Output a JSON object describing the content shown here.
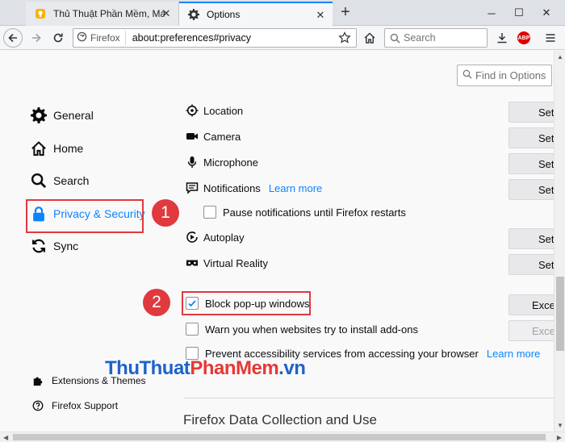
{
  "tabs": [
    {
      "label": "Thủ Thuật Phần Mềm, Máy Tính",
      "close": "✕"
    },
    {
      "label": "Options",
      "close": "✕"
    }
  ],
  "window": {
    "minimize": "─",
    "maximize": "☐",
    "close": "✕",
    "new_tab": "+"
  },
  "nav": {
    "identity_label": "Firefox",
    "url": "about:preferences#privacy",
    "search_placeholder": "Search",
    "abp_label": "ABP"
  },
  "find": {
    "placeholder": "Find in Options"
  },
  "sidebar": {
    "items": [
      {
        "label": "General"
      },
      {
        "label": "Home"
      },
      {
        "label": "Search"
      },
      {
        "label": "Privacy & Security"
      },
      {
        "label": "Sync"
      }
    ],
    "footer": [
      {
        "label": "Extensions & Themes"
      },
      {
        "label": "Firefox Support"
      }
    ]
  },
  "permissions": {
    "rows": [
      {
        "label": "Location",
        "button": "Settings..."
      },
      {
        "label": "Camera",
        "button": "Settings..."
      },
      {
        "label": "Microphone",
        "button": "Settings..."
      },
      {
        "label": "Notifications",
        "link": "Learn more",
        "button": "Settings..."
      },
      {
        "label": "Autoplay",
        "button": "Settings..."
      },
      {
        "label": "Virtual Reality",
        "button": "Settings..."
      }
    ],
    "pause_notifications": "Pause notifications until Firefox restarts",
    "block_popups": "Block pop-up windows",
    "block_popups_button": "Exceptions...",
    "warn_addons": "Warn you when websites try to install add-ons",
    "warn_addons_button": "Exceptions...",
    "prevent_accessibility": "Prevent accessibility services from accessing your browser",
    "prevent_accessibility_link": "Learn more"
  },
  "section_title": "Firefox Data Collection and Use",
  "annotations": {
    "one": "1",
    "two": "2"
  },
  "watermark": {
    "part1": "ThuThuat",
    "part2": "PhanMem",
    "part3": ".vn"
  },
  "colors": {
    "accent": "#0a84ff",
    "annotation": "#e0393e"
  }
}
